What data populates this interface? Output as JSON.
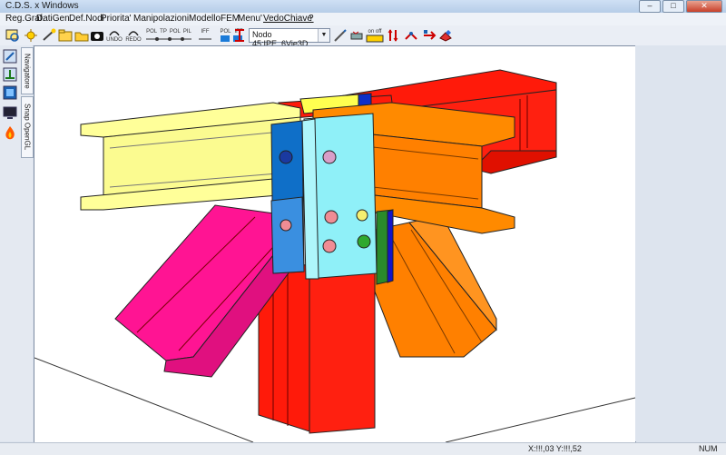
{
  "window": {
    "title": "C.D.S. x Windows",
    "min": "–",
    "max": "□",
    "close": "✕"
  },
  "menu": [
    "Reg.Graf.",
    "DatiGen",
    "Def.Nodi",
    "Priorita'",
    "Manipolazioni",
    "ModelloFEM",
    "Menu'",
    "VedoChiave",
    "?"
  ],
  "mdi_controls": [
    "–",
    "□",
    "✕"
  ],
  "toolbar": {
    "undo_label": "UNDO",
    "redo_label": "REDO",
    "pol_labels": [
      "POL",
      "TP",
      "POL",
      "PIL"
    ],
    "iff_label": "IFF",
    "pol2_labels": [
      "POL",
      "IFF"
    ],
    "onoff_label": "on off",
    "node_selector": "Nodo 45:IPE_6Vie3D"
  },
  "side_tabs": [
    "Navigatore",
    "Snap OpenGL"
  ],
  "colors": {
    "yellow_beam": "#ffff99",
    "red_beam": "#ff1a0a",
    "orange_beam": "#ff8000",
    "magenta_brace": "#ff1493",
    "cyan_plate": "#8ff0f8",
    "blue_plate": "#0f6fc8",
    "green_plate": "#33a833"
  },
  "status": {
    "coords": "X:!!!,03   Y:!!!,52",
    "num": "NUM"
  }
}
